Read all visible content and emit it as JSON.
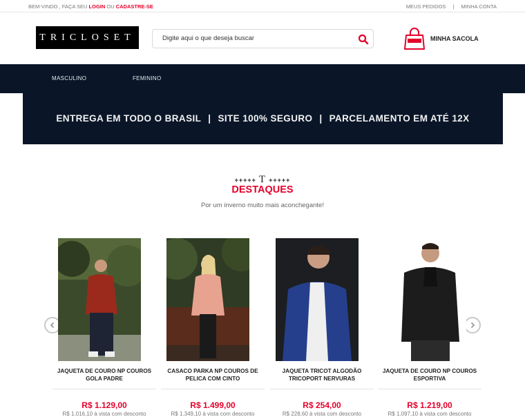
{
  "topbar": {
    "welcome_prefix": "BEM-VINDO , FAÇA SEU ",
    "login": "LOGIN",
    "ou": " OU ",
    "register": "CADASTRE-SE",
    "my_orders": "MEUS PEDIDOS",
    "separator": "|",
    "my_account": "MINHA CONTA"
  },
  "header": {
    "logo": "TRICLOSET",
    "search_placeholder": "Digite aqui o que deseja buscar",
    "bag_label": "MINHA SACOLA"
  },
  "nav": {
    "items": [
      "MASCULINO",
      "FEMININO"
    ]
  },
  "banner": {
    "part1": "ENTREGA EM TODO O BRASIL",
    "part2": "SITE 100% SEGURO",
    "part3": "PARCELAMENTO EM ATÉ 12X",
    "sep": "|"
  },
  "section": {
    "ornament_left": "+++++",
    "ornament_mark": "T",
    "ornament_right": "+++++",
    "title": "DESTAQUES",
    "subtitle": "Por um inverno muito mais aconchegante!"
  },
  "products": [
    {
      "name_line1": "JAQUETA DE COURO NP COUROS",
      "name_line2": "GOLA PADRE",
      "price": "R$ 1.129,00",
      "discount": "R$ 1.016,10 à vista com desconto",
      "photo": "man-red-leather-jacket"
    },
    {
      "name_line1": "CASACO PARKA NP COUROS DE",
      "name_line2": "PELICA COM CINTO",
      "price": "R$ 1.499,00",
      "discount": "R$ 1.349,10 à vista com desconto",
      "photo": "woman-pink-parka"
    },
    {
      "name_line1": "JAQUETA TRICOT ALGODÃO",
      "name_line2": "TRICOPORT NERVURAS",
      "price": "R$ 254,00",
      "discount": "R$ 228,60 à vista com desconto",
      "photo": "man-blue-knit-jacket"
    },
    {
      "name_line1": "JAQUETA DE COURO NP COUROS",
      "name_line2": "ESPORTIVA",
      "price": "R$ 1.219,00",
      "discount": "R$ 1.097,10 à vista com desconto",
      "photo": "man-black-leather-jacket"
    }
  ],
  "colors": {
    "accent": "#e4002b",
    "navy": "#0a1628"
  }
}
